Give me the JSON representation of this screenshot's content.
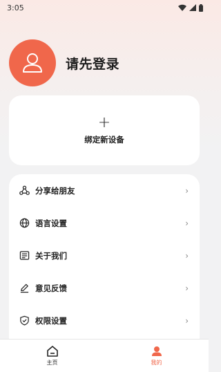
{
  "status_bar": {
    "time": "3:05"
  },
  "profile": {
    "login_prompt": "请先登录",
    "avatar_icon": "user-icon"
  },
  "device_card": {
    "add_symbol": "+",
    "label": "绑定新设备"
  },
  "menu": {
    "items": [
      {
        "label": "分享给朋友",
        "icon": "share-icon"
      },
      {
        "label": "语言设置",
        "icon": "globe-icon"
      },
      {
        "label": "关于我们",
        "icon": "document-icon"
      },
      {
        "label": "意见反馈",
        "icon": "edit-icon"
      },
      {
        "label": "权限设置",
        "icon": "shield-icon"
      }
    ],
    "chevron": "›"
  },
  "bottom_nav": {
    "home_label": "主页",
    "mine_label": "我的",
    "active_color": "#f0674b"
  },
  "colors": {
    "accent": "#f0674b"
  }
}
